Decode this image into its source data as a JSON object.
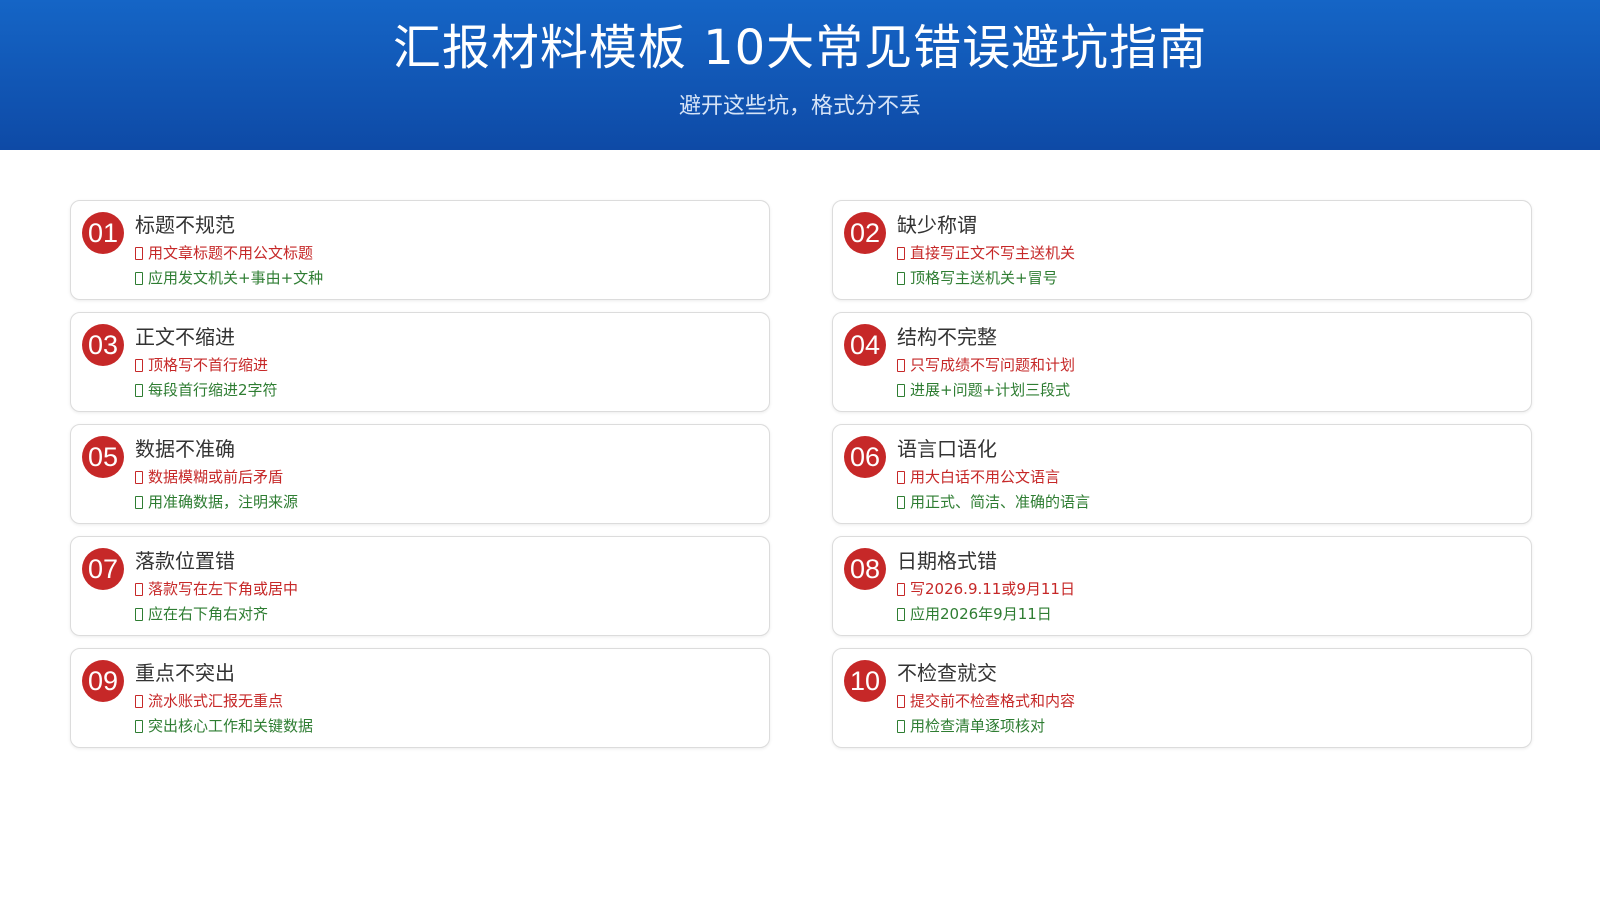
{
  "header": {
    "title": "汇报材料模板 10大常见错误避坑指南",
    "subtitle": "避开这些坑，格式分不丢"
  },
  "colors": {
    "header_bg": "#1565c6",
    "badge": "#c62828",
    "wrong_text": "#c62828",
    "right_text": "#2e7d32"
  },
  "items": [
    {
      "num": "01",
      "title": "标题不规范",
      "wrong": "用文章标题不用公文标题",
      "right": "应用发文机关+事由+文种"
    },
    {
      "num": "02",
      "title": "缺少称谓",
      "wrong": "直接写正文不写主送机关",
      "right": "顶格写主送机关+冒号"
    },
    {
      "num": "03",
      "title": "正文不缩进",
      "wrong": "顶格写不首行缩进",
      "right": "每段首行缩进2字符"
    },
    {
      "num": "04",
      "title": "结构不完整",
      "wrong": "只写成绩不写问题和计划",
      "right": "进展+问题+计划三段式"
    },
    {
      "num": "05",
      "title": "数据不准确",
      "wrong": "数据模糊或前后矛盾",
      "right": "用准确数据，注明来源"
    },
    {
      "num": "06",
      "title": "语言口语化",
      "wrong": "用大白话不用公文语言",
      "right": "用正式、简洁、准确的语言"
    },
    {
      "num": "07",
      "title": "落款位置错",
      "wrong": "落款写在左下角或居中",
      "right": "应在右下角右对齐"
    },
    {
      "num": "08",
      "title": "日期格式错",
      "wrong": "写2026.9.11或9月11日",
      "right": "应用2026年9月11日"
    },
    {
      "num": "09",
      "title": "重点不突出",
      "wrong": "流水账式汇报无重点",
      "right": "突出核心工作和关键数据"
    },
    {
      "num": "10",
      "title": "不检查就交",
      "wrong": "提交前不检查格式和内容",
      "right": "用检查清单逐项核对"
    }
  ]
}
